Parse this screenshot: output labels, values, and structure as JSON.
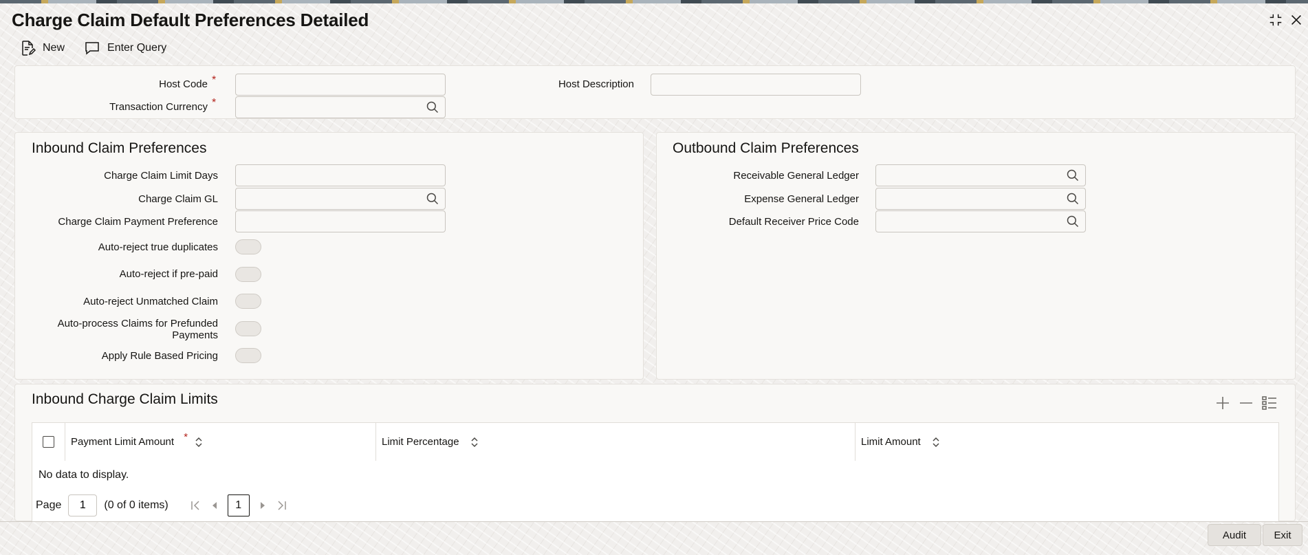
{
  "window": {
    "title": "Charge Claim Default Preferences Detailed"
  },
  "toolbar": {
    "new_label": "New",
    "enter_query_label": "Enter Query"
  },
  "header": {
    "host_code_label": "Host Code",
    "host_description_label": "Host Description",
    "transaction_currency_label": "Transaction Currency",
    "required_mark": "*"
  },
  "inbound": {
    "title": "Inbound Claim Preferences",
    "limit_days_label": "Charge Claim Limit Days",
    "gl_label": "Charge Claim GL",
    "payment_pref_label": "Charge Claim Payment Preference",
    "auto_reject_dup_label": "Auto-reject true duplicates",
    "auto_reject_prepaid_label": "Auto-reject if pre-paid",
    "auto_reject_unmatched_label": "Auto-reject Unmatched Claim",
    "auto_process_line1": "Auto-process Claims for Prefunded",
    "auto_process_line2": "Payments",
    "apply_rule_label": "Apply Rule Based Pricing"
  },
  "outbound": {
    "title": "Outbound Claim Preferences",
    "receivable_gl_label": "Receivable General Ledger",
    "expense_gl_label": "Expense General Ledger",
    "receiver_price_code_label": "Default Receiver Price Code"
  },
  "limits": {
    "title": "Inbound Charge Claim Limits",
    "columns": [
      "Payment Limit Amount",
      "Limit Percentage",
      "Limit Amount"
    ],
    "empty_text": "No data to display.",
    "page_label": "Page",
    "page_value": "1",
    "items_text": "(0 of 0 items)",
    "current_page": "1"
  },
  "footer": {
    "audit_label": "Audit",
    "exit_label": "Exit"
  }
}
